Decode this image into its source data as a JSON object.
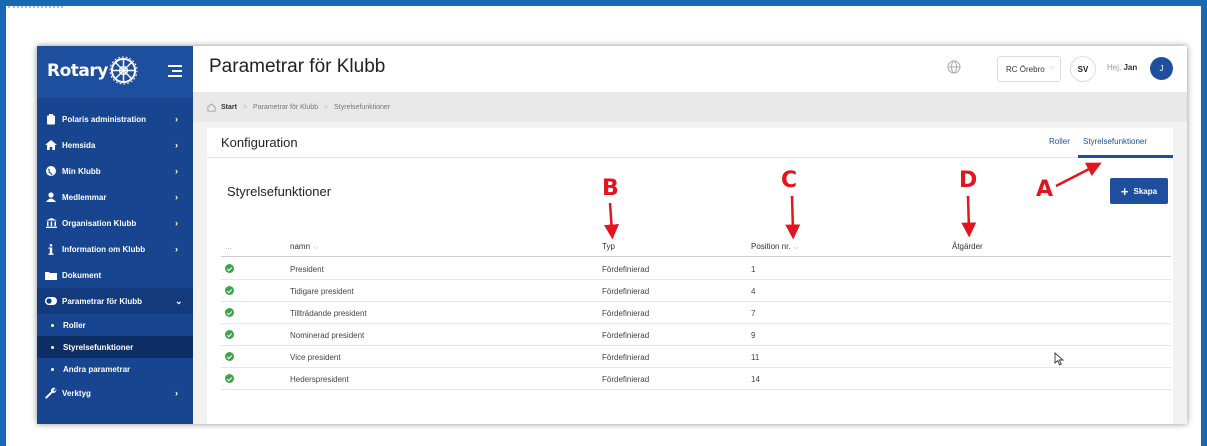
{
  "colors": {
    "sidebar": "#17458f",
    "accent": "#1e4e9e",
    "frame": "#1868b4",
    "success": "#3ca34a",
    "annotation": "#e2141d"
  },
  "brand": {
    "name": "Rotary",
    "logo_icon": "rotary-wheel-icon"
  },
  "sidebar": {
    "items": [
      {
        "label": "Polaris administration",
        "icon": "clipboard-icon",
        "chevron": "›"
      },
      {
        "label": "Hemsida",
        "icon": "home-icon",
        "chevron": "›"
      },
      {
        "label": "Min Klubb",
        "icon": "globe-icon",
        "chevron": "›"
      },
      {
        "label": "Medlemmar",
        "icon": "user-icon",
        "chevron": "›"
      },
      {
        "label": "Organisation Klubb",
        "icon": "building-icon",
        "chevron": "›"
      },
      {
        "label": "Information om Klubb",
        "icon": "info-icon",
        "chevron": "›"
      },
      {
        "label": "Dokument",
        "icon": "folder-icon",
        "chevron": ""
      },
      {
        "label": "Parametrar för Klubb",
        "icon": "toggle-icon",
        "chevron": "⌄"
      }
    ],
    "sub_items": [
      {
        "label": "Roller"
      },
      {
        "label": "Styrelsefunktioner"
      },
      {
        "label": "Andra parametrar"
      }
    ],
    "tools": {
      "label": "Verktyg",
      "icon": "wrench-icon",
      "chevron": "›"
    }
  },
  "header": {
    "title": "Parametrar för Klubb",
    "club": "RC Örebro",
    "language": "SV",
    "greeting_prefix": "Hej,",
    "user_name": "Jan",
    "avatar_initial": "J"
  },
  "breadcrumb": {
    "home": "Start",
    "items": [
      "Parametrar för Klubb",
      "Styrelsefunktioner"
    ]
  },
  "panel": {
    "title": "Konfiguration",
    "tabs": [
      {
        "label": "Roller"
      },
      {
        "label": "Styrelsefunktioner",
        "active": true
      }
    ],
    "section_title": "Styrelsefunktioner",
    "create_button": "Skapa"
  },
  "table": {
    "columns": {
      "menu": "...",
      "name": "namn",
      "type": "Typ",
      "position": "Position nr.",
      "actions": "Åtgärder"
    },
    "rows": [
      {
        "name": "President",
        "type": "Fördefinierad",
        "position": "1"
      },
      {
        "name": "Tidigare president",
        "type": "Fördefinierad",
        "position": "4"
      },
      {
        "name": "Tillträdande president",
        "type": "Fördefinierad",
        "position": "7"
      },
      {
        "name": "Nominerad president",
        "type": "Fördefinierad",
        "position": "9"
      },
      {
        "name": "Vice president",
        "type": "Fördefinierad",
        "position": "11"
      },
      {
        "name": "Hederspresident",
        "type": "Fördefinierad",
        "position": "14"
      }
    ]
  },
  "annotations": {
    "a": "A",
    "b": "B",
    "c": "C",
    "d": "D"
  }
}
